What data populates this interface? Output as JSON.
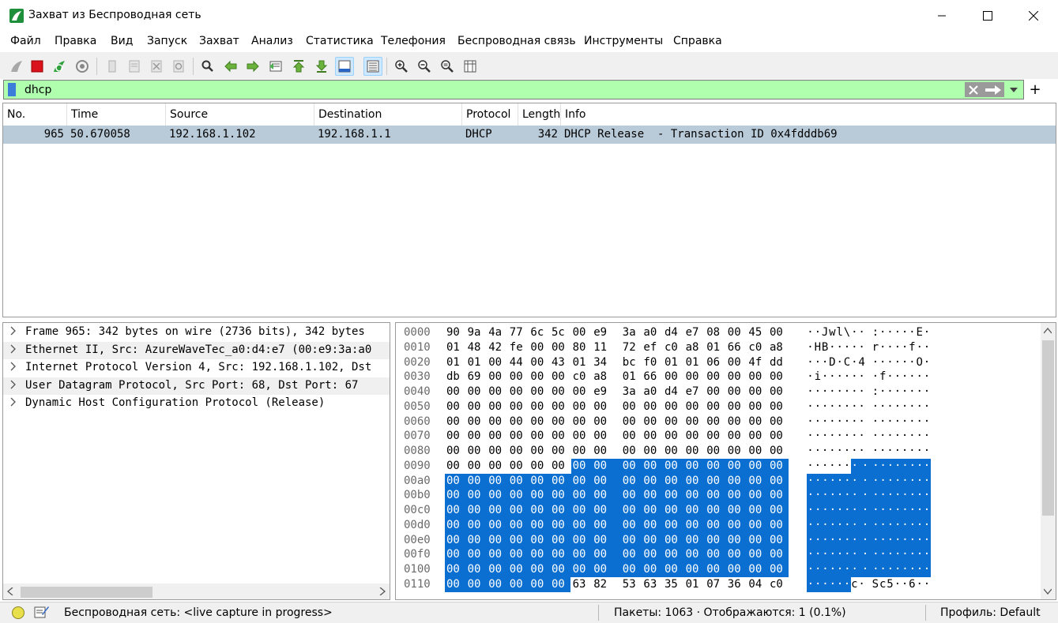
{
  "window": {
    "title": "Захват из Беспроводная сеть",
    "minimize": "—",
    "maximize": "☐",
    "close": "✕"
  },
  "menu": [
    "Файл",
    "Правка",
    "Вид",
    "Запуск",
    "Захват",
    "Анализ",
    "Статистика",
    "Телефония",
    "Беспроводная связь",
    "Инструменты",
    "Справка"
  ],
  "filter": {
    "value": "dhcp",
    "background_color": "#afffaf",
    "add_label": "+"
  },
  "packet_list": {
    "columns": [
      "No.",
      "Time",
      "Source",
      "Destination",
      "Protocol",
      "Length",
      "Info"
    ],
    "rows": [
      {
        "no": "965",
        "time": "50.670058",
        "source": "192.168.1.102",
        "destination": "192.168.1.1",
        "protocol": "DHCP",
        "length": "342",
        "info": "DHCP Release  - Transaction ID 0x4fdddb69"
      }
    ]
  },
  "details": [
    "Frame 965: 342 bytes on wire (2736 bits), 342 bytes",
    "Ethernet II, Src: AzureWaveTec_a0:d4:e7 (00:e9:3a:a0",
    "Internet Protocol Version 4, Src: 192.168.1.102, Dst",
    "User Datagram Protocol, Src Port: 68, Dst Port: 67",
    "Dynamic Host Configuration Protocol (Release)"
  ],
  "bytes": {
    "selection_color": "#0a6fd0",
    "selection_start": 150,
    "selection_end": 277,
    "rows": [
      {
        "offset": "0000",
        "hex": [
          "90",
          "9a",
          "4a",
          "77",
          "6c",
          "5c",
          "00",
          "e9",
          "3a",
          "a0",
          "d4",
          "e7",
          "08",
          "00",
          "45",
          "00"
        ],
        "ascii": [
          "·",
          "·",
          "J",
          "w",
          "l",
          "\\",
          "·",
          "·",
          ":",
          "·",
          "·",
          "·",
          "·",
          "·",
          "E",
          "·"
        ]
      },
      {
        "offset": "0010",
        "hex": [
          "01",
          "48",
          "42",
          "fe",
          "00",
          "00",
          "80",
          "11",
          "72",
          "ef",
          "c0",
          "a8",
          "01",
          "66",
          "c0",
          "a8"
        ],
        "ascii": [
          "·",
          "H",
          "B",
          "·",
          "·",
          "·",
          "·",
          "·",
          "r",
          "·",
          "·",
          "·",
          "·",
          "f",
          "·",
          "·"
        ]
      },
      {
        "offset": "0020",
        "hex": [
          "01",
          "01",
          "00",
          "44",
          "00",
          "43",
          "01",
          "34",
          "bc",
          "f0",
          "01",
          "01",
          "06",
          "00",
          "4f",
          "dd"
        ],
        "ascii": [
          "·",
          "·",
          "·",
          "D",
          "·",
          "C",
          "·",
          "4",
          "·",
          "·",
          "·",
          "·",
          "·",
          "·",
          "O",
          "·"
        ]
      },
      {
        "offset": "0030",
        "hex": [
          "db",
          "69",
          "00",
          "00",
          "00",
          "00",
          "c0",
          "a8",
          "01",
          "66",
          "00",
          "00",
          "00",
          "00",
          "00",
          "00"
        ],
        "ascii": [
          "·",
          "i",
          "·",
          "·",
          "·",
          "·",
          "·",
          "·",
          "·",
          "f",
          "·",
          "·",
          "·",
          "·",
          "·",
          "·"
        ]
      },
      {
        "offset": "0040",
        "hex": [
          "00",
          "00",
          "00",
          "00",
          "00",
          "00",
          "00",
          "e9",
          "3a",
          "a0",
          "d4",
          "e7",
          "00",
          "00",
          "00",
          "00"
        ],
        "ascii": [
          "·",
          "·",
          "·",
          "·",
          "·",
          "·",
          "·",
          "·",
          ":",
          "·",
          "·",
          "·",
          "·",
          "·",
          "·",
          "·"
        ]
      },
      {
        "offset": "0050",
        "hex": [
          "00",
          "00",
          "00",
          "00",
          "00",
          "00",
          "00",
          "00",
          "00",
          "00",
          "00",
          "00",
          "00",
          "00",
          "00",
          "00"
        ],
        "ascii": [
          "·",
          "·",
          "·",
          "·",
          "·",
          "·",
          "·",
          "·",
          "·",
          "·",
          "·",
          "·",
          "·",
          "·",
          "·",
          "·"
        ]
      },
      {
        "offset": "0060",
        "hex": [
          "00",
          "00",
          "00",
          "00",
          "00",
          "00",
          "00",
          "00",
          "00",
          "00",
          "00",
          "00",
          "00",
          "00",
          "00",
          "00"
        ],
        "ascii": [
          "·",
          "·",
          "·",
          "·",
          "·",
          "·",
          "·",
          "·",
          "·",
          "·",
          "·",
          "·",
          "·",
          "·",
          "·",
          "·"
        ]
      },
      {
        "offset": "0070",
        "hex": [
          "00",
          "00",
          "00",
          "00",
          "00",
          "00",
          "00",
          "00",
          "00",
          "00",
          "00",
          "00",
          "00",
          "00",
          "00",
          "00"
        ],
        "ascii": [
          "·",
          "·",
          "·",
          "·",
          "·",
          "·",
          "·",
          "·",
          "·",
          "·",
          "·",
          "·",
          "·",
          "·",
          "·",
          "·"
        ]
      },
      {
        "offset": "0080",
        "hex": [
          "00",
          "00",
          "00",
          "00",
          "00",
          "00",
          "00",
          "00",
          "00",
          "00",
          "00",
          "00",
          "00",
          "00",
          "00",
          "00"
        ],
        "ascii": [
          "·",
          "·",
          "·",
          "·",
          "·",
          "·",
          "·",
          "·",
          "·",
          "·",
          "·",
          "·",
          "·",
          "·",
          "·",
          "·"
        ]
      },
      {
        "offset": "0090",
        "hex": [
          "00",
          "00",
          "00",
          "00",
          "00",
          "00",
          "00",
          "00",
          "00",
          "00",
          "00",
          "00",
          "00",
          "00",
          "00",
          "00"
        ],
        "ascii": [
          "·",
          "·",
          "·",
          "·",
          "·",
          "·",
          "·",
          "·",
          "·",
          "·",
          "·",
          "·",
          "·",
          "·",
          "·",
          "·"
        ]
      },
      {
        "offset": "00a0",
        "hex": [
          "00",
          "00",
          "00",
          "00",
          "00",
          "00",
          "00",
          "00",
          "00",
          "00",
          "00",
          "00",
          "00",
          "00",
          "00",
          "00"
        ],
        "ascii": [
          "·",
          "·",
          "·",
          "·",
          "·",
          "·",
          "·",
          "·",
          "·",
          "·",
          "·",
          "·",
          "·",
          "·",
          "·",
          "·"
        ]
      },
      {
        "offset": "00b0",
        "hex": [
          "00",
          "00",
          "00",
          "00",
          "00",
          "00",
          "00",
          "00",
          "00",
          "00",
          "00",
          "00",
          "00",
          "00",
          "00",
          "00"
        ],
        "ascii": [
          "·",
          "·",
          "·",
          "·",
          "·",
          "·",
          "·",
          "·",
          "·",
          "·",
          "·",
          "·",
          "·",
          "·",
          "·",
          "·"
        ]
      },
      {
        "offset": "00c0",
        "hex": [
          "00",
          "00",
          "00",
          "00",
          "00",
          "00",
          "00",
          "00",
          "00",
          "00",
          "00",
          "00",
          "00",
          "00",
          "00",
          "00"
        ],
        "ascii": [
          "·",
          "·",
          "·",
          "·",
          "·",
          "·",
          "·",
          "·",
          "·",
          "·",
          "·",
          "·",
          "·",
          "·",
          "·",
          "·"
        ]
      },
      {
        "offset": "00d0",
        "hex": [
          "00",
          "00",
          "00",
          "00",
          "00",
          "00",
          "00",
          "00",
          "00",
          "00",
          "00",
          "00",
          "00",
          "00",
          "00",
          "00"
        ],
        "ascii": [
          "·",
          "·",
          "·",
          "·",
          "·",
          "·",
          "·",
          "·",
          "·",
          "·",
          "·",
          "·",
          "·",
          "·",
          "·",
          "·"
        ]
      },
      {
        "offset": "00e0",
        "hex": [
          "00",
          "00",
          "00",
          "00",
          "00",
          "00",
          "00",
          "00",
          "00",
          "00",
          "00",
          "00",
          "00",
          "00",
          "00",
          "00"
        ],
        "ascii": [
          "·",
          "·",
          "·",
          "·",
          "·",
          "·",
          "·",
          "·",
          "·",
          "·",
          "·",
          "·",
          "·",
          "·",
          "·",
          "·"
        ]
      },
      {
        "offset": "00f0",
        "hex": [
          "00",
          "00",
          "00",
          "00",
          "00",
          "00",
          "00",
          "00",
          "00",
          "00",
          "00",
          "00",
          "00",
          "00",
          "00",
          "00"
        ],
        "ascii": [
          "·",
          "·",
          "·",
          "·",
          "·",
          "·",
          "·",
          "·",
          "·",
          "·",
          "·",
          "·",
          "·",
          "·",
          "·",
          "·"
        ]
      },
      {
        "offset": "0100",
        "hex": [
          "00",
          "00",
          "00",
          "00",
          "00",
          "00",
          "00",
          "00",
          "00",
          "00",
          "00",
          "00",
          "00",
          "00",
          "00",
          "00"
        ],
        "ascii": [
          "·",
          "·",
          "·",
          "·",
          "·",
          "·",
          "·",
          "·",
          "·",
          "·",
          "·",
          "·",
          "·",
          "·",
          "·",
          "·"
        ]
      },
      {
        "offset": "0110",
        "hex": [
          "00",
          "00",
          "00",
          "00",
          "00",
          "00",
          "63",
          "82",
          "53",
          "63",
          "35",
          "01",
          "07",
          "36",
          "04",
          "c0"
        ],
        "ascii": [
          "·",
          "·",
          "·",
          "·",
          "·",
          "·",
          "c",
          "·",
          "S",
          "c",
          "5",
          "·",
          "·",
          "6",
          "·",
          "·"
        ]
      }
    ]
  },
  "status": {
    "interface": "Беспроводная сеть: <live capture in progress>",
    "packets": "Пакеты: 1063 · Отображаются: 1 (0.1%)",
    "profile": "Профиль: Default"
  }
}
